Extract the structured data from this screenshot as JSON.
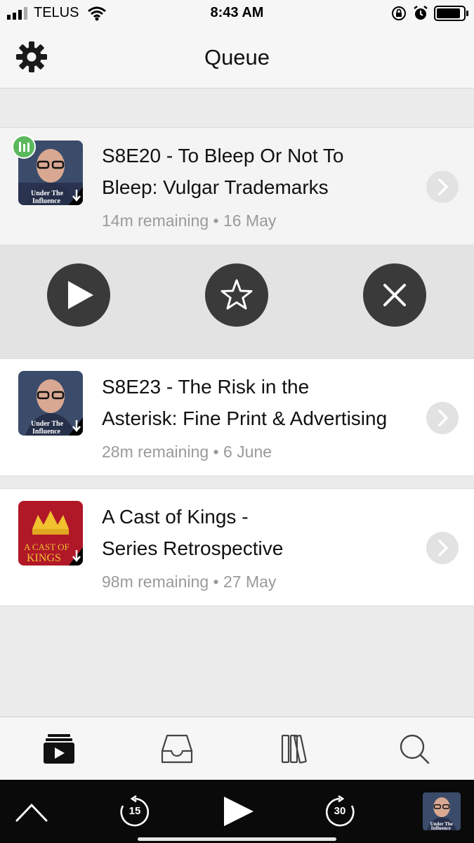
{
  "status_bar": {
    "carrier": "TELUS",
    "time": "8:43 AM"
  },
  "nav": {
    "title": "Queue",
    "settings_icon": "gear-icon"
  },
  "queue": [
    {
      "title_line1": "S8E20 - To Bleep Or Not To",
      "title_line2": "Bleep: Vulgar Trademarks",
      "remaining": "14m remaining",
      "date": "16 May",
      "art_caption": "Under The Influence",
      "now_playing": true
    },
    {
      "title_line1": "S8E23 - The Risk in the",
      "title_line2": "Asterisk: Fine Print & Advertising",
      "remaining": "28m remaining",
      "date": "6 June",
      "art_caption": "Under The Influence",
      "now_playing": false
    },
    {
      "title_line1": "A Cast of Kings -",
      "title_line2": "Series Retrospective",
      "remaining": "98m remaining",
      "date": "27 May",
      "art_caption": "A CAST OF KINGS",
      "now_playing": false
    }
  ],
  "actions": [
    "play-icon",
    "star-icon",
    "close-icon"
  ],
  "tabs": [
    "up-next-icon",
    "inbox-icon",
    "library-icon",
    "search-icon"
  ],
  "player": {
    "skip_back_seconds": "15",
    "skip_forward_seconds": "30"
  },
  "colors": {
    "accent_green": "#5cb85c",
    "action_button": "#3a3a3a",
    "meta_gray": "#9a9a9a"
  }
}
